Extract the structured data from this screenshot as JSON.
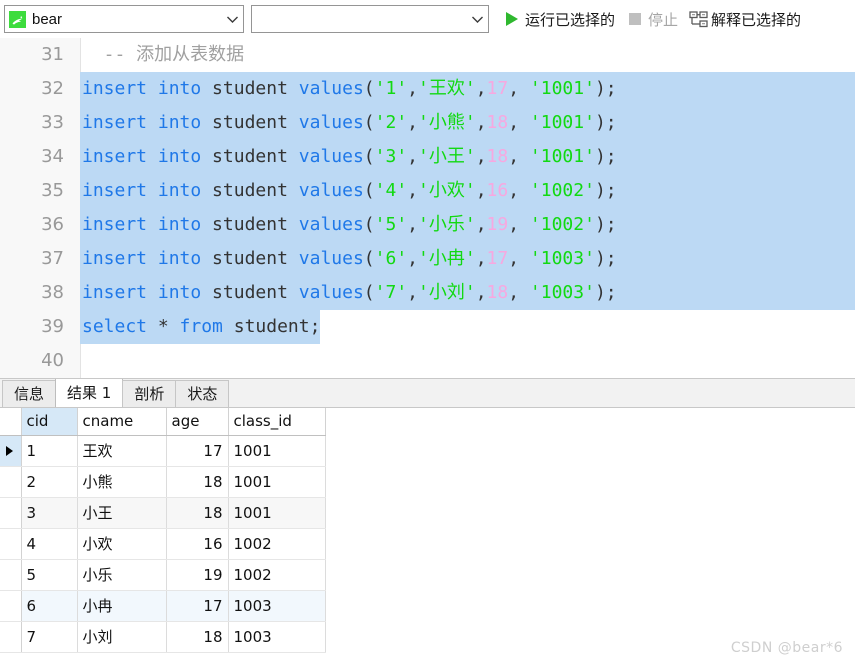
{
  "toolbar": {
    "db_combo": {
      "value": "bear",
      "icon": "mysql-dolphin-icon"
    },
    "schema_combo": {
      "value": "",
      "placeholder": ""
    },
    "run_selected": {
      "label": "运行已选择的",
      "icon": "play-icon"
    },
    "stop": {
      "label": "停止",
      "icon": "stop-icon",
      "disabled": true
    },
    "explain_selected": {
      "label": "解释已选择的",
      "icon": "explain-plan-icon"
    }
  },
  "editor": {
    "lines": [
      {
        "no": "31",
        "selected": false,
        "full": false,
        "tokens": [
          {
            "t": "cmt",
            "s": "  -- 添加从表数据"
          }
        ]
      },
      {
        "no": "32",
        "selected": true,
        "full": true,
        "tokens": [
          {
            "t": "kw",
            "s": "insert into"
          },
          {
            "t": "pl",
            "s": " student "
          },
          {
            "t": "kw",
            "s": "values"
          },
          {
            "t": "pl",
            "s": "("
          },
          {
            "t": "str",
            "s": "'1'"
          },
          {
            "t": "pl",
            "s": ","
          },
          {
            "t": "str",
            "s": "'王欢'"
          },
          {
            "t": "pl",
            "s": ","
          },
          {
            "t": "num",
            "s": "17"
          },
          {
            "t": "pl",
            "s": ", "
          },
          {
            "t": "str",
            "s": "'1001'"
          },
          {
            "t": "pl",
            "s": ");"
          }
        ]
      },
      {
        "no": "33",
        "selected": true,
        "full": true,
        "tokens": [
          {
            "t": "kw",
            "s": "insert into"
          },
          {
            "t": "pl",
            "s": " student "
          },
          {
            "t": "kw",
            "s": "values"
          },
          {
            "t": "pl",
            "s": "("
          },
          {
            "t": "str",
            "s": "'2'"
          },
          {
            "t": "pl",
            "s": ","
          },
          {
            "t": "str",
            "s": "'小熊'"
          },
          {
            "t": "pl",
            "s": ","
          },
          {
            "t": "num",
            "s": "18"
          },
          {
            "t": "pl",
            "s": ", "
          },
          {
            "t": "str",
            "s": "'1001'"
          },
          {
            "t": "pl",
            "s": ");"
          }
        ]
      },
      {
        "no": "34",
        "selected": true,
        "full": true,
        "tokens": [
          {
            "t": "kw",
            "s": "insert into"
          },
          {
            "t": "pl",
            "s": " student "
          },
          {
            "t": "kw",
            "s": "values"
          },
          {
            "t": "pl",
            "s": "("
          },
          {
            "t": "str",
            "s": "'3'"
          },
          {
            "t": "pl",
            "s": ","
          },
          {
            "t": "str",
            "s": "'小王'"
          },
          {
            "t": "pl",
            "s": ","
          },
          {
            "t": "num",
            "s": "18"
          },
          {
            "t": "pl",
            "s": ", "
          },
          {
            "t": "str",
            "s": "'1001'"
          },
          {
            "t": "pl",
            "s": ");"
          }
        ]
      },
      {
        "no": "35",
        "selected": true,
        "full": true,
        "tokens": [
          {
            "t": "kw",
            "s": "insert into"
          },
          {
            "t": "pl",
            "s": " student "
          },
          {
            "t": "kw",
            "s": "values"
          },
          {
            "t": "pl",
            "s": "("
          },
          {
            "t": "str",
            "s": "'4'"
          },
          {
            "t": "pl",
            "s": ","
          },
          {
            "t": "str",
            "s": "'小欢'"
          },
          {
            "t": "pl",
            "s": ","
          },
          {
            "t": "num",
            "s": "16"
          },
          {
            "t": "pl",
            "s": ", "
          },
          {
            "t": "str",
            "s": "'1002'"
          },
          {
            "t": "pl",
            "s": ");"
          }
        ]
      },
      {
        "no": "36",
        "selected": true,
        "full": true,
        "tokens": [
          {
            "t": "kw",
            "s": "insert into"
          },
          {
            "t": "pl",
            "s": " student "
          },
          {
            "t": "kw",
            "s": "values"
          },
          {
            "t": "pl",
            "s": "("
          },
          {
            "t": "str",
            "s": "'5'"
          },
          {
            "t": "pl",
            "s": ","
          },
          {
            "t": "str",
            "s": "'小乐'"
          },
          {
            "t": "pl",
            "s": ","
          },
          {
            "t": "num",
            "s": "19"
          },
          {
            "t": "pl",
            "s": ", "
          },
          {
            "t": "str",
            "s": "'1002'"
          },
          {
            "t": "pl",
            "s": ");"
          }
        ]
      },
      {
        "no": "37",
        "selected": true,
        "full": true,
        "tokens": [
          {
            "t": "kw",
            "s": "insert into"
          },
          {
            "t": "pl",
            "s": " student "
          },
          {
            "t": "kw",
            "s": "values"
          },
          {
            "t": "pl",
            "s": "("
          },
          {
            "t": "str",
            "s": "'6'"
          },
          {
            "t": "pl",
            "s": ","
          },
          {
            "t": "str",
            "s": "'小冉'"
          },
          {
            "t": "pl",
            "s": ","
          },
          {
            "t": "num",
            "s": "17"
          },
          {
            "t": "pl",
            "s": ", "
          },
          {
            "t": "str",
            "s": "'1003'"
          },
          {
            "t": "pl",
            "s": ");"
          }
        ]
      },
      {
        "no": "38",
        "selected": true,
        "full": true,
        "tokens": [
          {
            "t": "kw",
            "s": "insert into"
          },
          {
            "t": "pl",
            "s": " student "
          },
          {
            "t": "kw",
            "s": "values"
          },
          {
            "t": "pl",
            "s": "("
          },
          {
            "t": "str",
            "s": "'7'"
          },
          {
            "t": "pl",
            "s": ","
          },
          {
            "t": "str",
            "s": "'小刘'"
          },
          {
            "t": "pl",
            "s": ","
          },
          {
            "t": "num",
            "s": "18"
          },
          {
            "t": "pl",
            "s": ", "
          },
          {
            "t": "str",
            "s": "'1003'"
          },
          {
            "t": "pl",
            "s": ");"
          }
        ]
      },
      {
        "no": "39",
        "selected": true,
        "full": false,
        "tokens": [
          {
            "t": "kw",
            "s": "select"
          },
          {
            "t": "pl",
            "s": " * "
          },
          {
            "t": "kw",
            "s": "from"
          },
          {
            "t": "pl",
            "s": " student;"
          }
        ]
      },
      {
        "no": "40",
        "selected": false,
        "full": false,
        "tokens": []
      }
    ]
  },
  "result_tabs": [
    {
      "label": "信息",
      "active": false
    },
    {
      "label": "结果 1",
      "active": true
    },
    {
      "label": "剖析",
      "active": false
    },
    {
      "label": "状态",
      "active": false
    }
  ],
  "grid": {
    "columns": [
      "cid",
      "cname",
      "age",
      "class_id"
    ],
    "highlighted_column": "cid",
    "rows": [
      {
        "cid": "1",
        "cname": "王欢",
        "age": "17",
        "class_id": "1001",
        "current": true,
        "alt": false,
        "hover": false
      },
      {
        "cid": "2",
        "cname": "小熊",
        "age": "18",
        "class_id": "1001",
        "current": false,
        "alt": false,
        "hover": false
      },
      {
        "cid": "3",
        "cname": "小王",
        "age": "18",
        "class_id": "1001",
        "current": false,
        "alt": true,
        "hover": false
      },
      {
        "cid": "4",
        "cname": "小欢",
        "age": "16",
        "class_id": "1002",
        "current": false,
        "alt": false,
        "hover": false
      },
      {
        "cid": "5",
        "cname": "小乐",
        "age": "19",
        "class_id": "1002",
        "current": false,
        "alt": false,
        "hover": false
      },
      {
        "cid": "6",
        "cname": "小冉",
        "age": "17",
        "class_id": "1003",
        "current": false,
        "alt": false,
        "hover": true
      },
      {
        "cid": "7",
        "cname": "小刘",
        "age": "18",
        "class_id": "1003",
        "current": false,
        "alt": false,
        "hover": false
      }
    ]
  },
  "watermark": "CSDN @bear*6",
  "colors": {
    "selection": "#bcd9f4",
    "keyword": "#1f78e8",
    "string": "#12d912",
    "number": "#f7a8e0",
    "comment": "#a0a0a0",
    "run_icon": "#2fb82f",
    "header_highlight": "#d6e8f7"
  }
}
